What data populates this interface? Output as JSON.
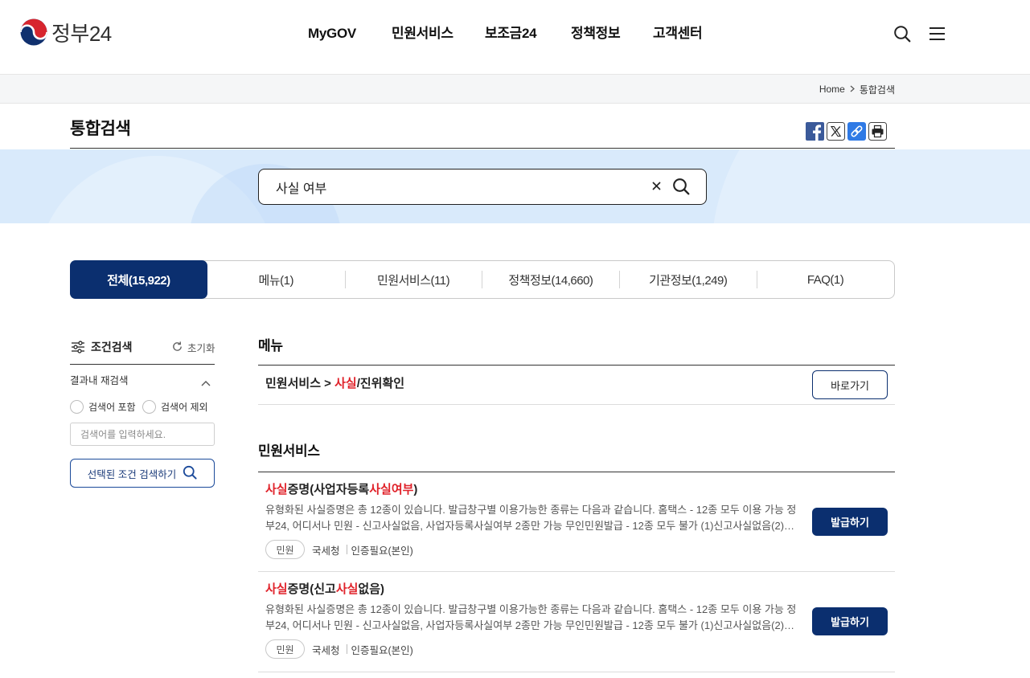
{
  "header": {
    "logo_text": "정부24",
    "logo_icon": "government-emblem-icon",
    "nav": [
      "MyGOV",
      "민원서비스",
      "보조금24",
      "정책정보",
      "고객센터"
    ],
    "utility_icons": [
      "search-icon",
      "hamburger-menu-icon"
    ]
  },
  "breadcrumb": {
    "home": "Home",
    "separator_icon": "chevron-right-icon",
    "current": "통합검색"
  },
  "page": {
    "title": "통합검색",
    "share_icons": [
      "facebook-icon",
      "x-icon",
      "link-icon",
      "print-icon"
    ]
  },
  "search": {
    "query": "사실 여부",
    "clear_icon": "close-icon",
    "submit_icon": "search-icon"
  },
  "tabs": [
    {
      "label": "전체(15,922)",
      "active": true
    },
    {
      "label": "메뉴(1)",
      "active": false
    },
    {
      "label": "민원서비스(11)",
      "active": false
    },
    {
      "label": "정책정보(14,660)",
      "active": false
    },
    {
      "label": "기관정보(1,249)",
      "active": false
    },
    {
      "label": "FAQ(1)",
      "active": false
    }
  ],
  "sidebar": {
    "title": "조건검색",
    "title_icon": "filter-sliders-icon",
    "reset": "초기화",
    "reset_icon": "refresh-icon",
    "refine_title": "결과내 재검색",
    "options": [
      {
        "label": "검색어 포함",
        "checked": false
      },
      {
        "label": "검색어 제외",
        "checked": false
      }
    ],
    "input_placeholder": "검색어를 입력하세요.",
    "submit": "선택된 조건 검색하기"
  },
  "menu_section": {
    "heading": "메뉴",
    "items": [
      {
        "path_parts": [
          {
            "text": "민원서비스 > ",
            "hl": false
          },
          {
            "text": "사실",
            "hl": true
          },
          {
            "text": "/진위확인",
            "hl": false
          }
        ],
        "button": "바로가기"
      }
    ]
  },
  "civil_section": {
    "heading": "민원서비스",
    "items": [
      {
        "title_parts": [
          {
            "text": "사실",
            "hl": true
          },
          {
            "text": "증명(사업자등록",
            "hl": false
          },
          {
            "text": "사실여부",
            "hl": true
          },
          {
            "text": ")",
            "hl": false
          }
        ],
        "description": "유형화된 사실증명은 총 12종이 있습니다. 발급창구별 이용가능한 종류는 다음과 같습니다. 홈택스 - 12종 모두 이용 가능 정부24, 어디서나 민원 - 신고사실없음, 사업자등록사실여부 2종만 가능 무인민원발급 - 12종 모두 불가 (1)신고사실없음(2)사업자등…",
        "tags": {
          "type": "민원",
          "agency": "국세청",
          "auth": "인증필요(본인)"
        },
        "button": "발급하기"
      },
      {
        "title_parts": [
          {
            "text": "사실",
            "hl": true
          },
          {
            "text": "증명(신고",
            "hl": false
          },
          {
            "text": "사실",
            "hl": true
          },
          {
            "text": "없음)",
            "hl": false
          }
        ],
        "description": "유형화된 사실증명은 총 12종이 있습니다. 발급창구별 이용가능한 종류는 다음과 같습니다. 홈택스 - 12종 모두 이용 가능 정부24, 어디서나 민원 - 신고사실없음, 사업자등록사실여부 2종만 가능 무인민원발급 - 12종 모두 불가 (1)신고사실없음(2)사업자등…",
        "tags": {
          "type": "민원",
          "agency": "국세청",
          "auth": "인증필요(본인)"
        },
        "button": "발급하기"
      }
    ]
  },
  "colors": {
    "primary": "#0b2f6f",
    "highlight": "#e0222a",
    "band": "#d9eafb"
  }
}
